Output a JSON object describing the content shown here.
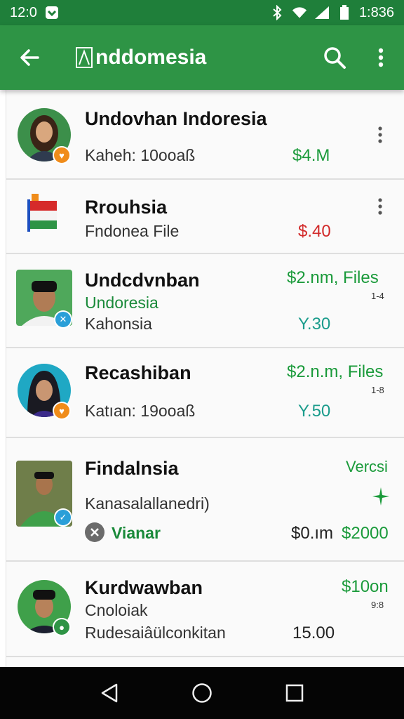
{
  "status_bar": {
    "time": "12:0",
    "right_text": "1:836",
    "icons": [
      "notification-icon",
      "bluetooth-icon",
      "wifi-icon",
      "signal-icon",
      "battery-icon"
    ]
  },
  "app_bar": {
    "title": "nddomesia",
    "back_icon": "arrow-back-icon",
    "search_icon": "search-icon",
    "menu_icon": "more-vert-icon"
  },
  "items": [
    {
      "name": "Undovhan Indoresia",
      "line2": "Kaheh: 10ooaß",
      "amount": "$4.M"
    },
    {
      "name": "Rrouhsia",
      "line2": "Fndonea File",
      "amount": "$.40"
    },
    {
      "name": "Undcdvnban",
      "line2": "Undoresia",
      "line3": "Kahonsia",
      "amount": "$2.nm, Files",
      "tiny": "1-4",
      "amount2": "Y.30"
    },
    {
      "name": "Recashiban",
      "line2": "Katıan: 19ooaß",
      "amount": "$2.n.m, Files",
      "tiny": "1-8",
      "amount2": "Y.50"
    },
    {
      "name": "Findalnsia",
      "line2": "Kanasalallanedri)",
      "tag": "Vianar",
      "amount": "Vercsi",
      "amount_dark": "$0.ım",
      "amount2": "$2000"
    },
    {
      "name": "Kurdwawban",
      "line2": "Cnoloiak",
      "line3": "Rudesaiâülconkitan",
      "amount": "$10on",
      "tiny": "9:8",
      "amount2": "15.00"
    }
  ],
  "colors": {
    "status_bar": "#1f7f3a",
    "app_bar": "#2e9445",
    "amount_green": "#1a9a3a",
    "amount_red": "#d22a2a",
    "amount_teal": "#1b9c8c"
  },
  "nav_bar": {
    "icons": [
      "nav-back-icon",
      "nav-home-icon",
      "nav-recents-icon"
    ]
  }
}
